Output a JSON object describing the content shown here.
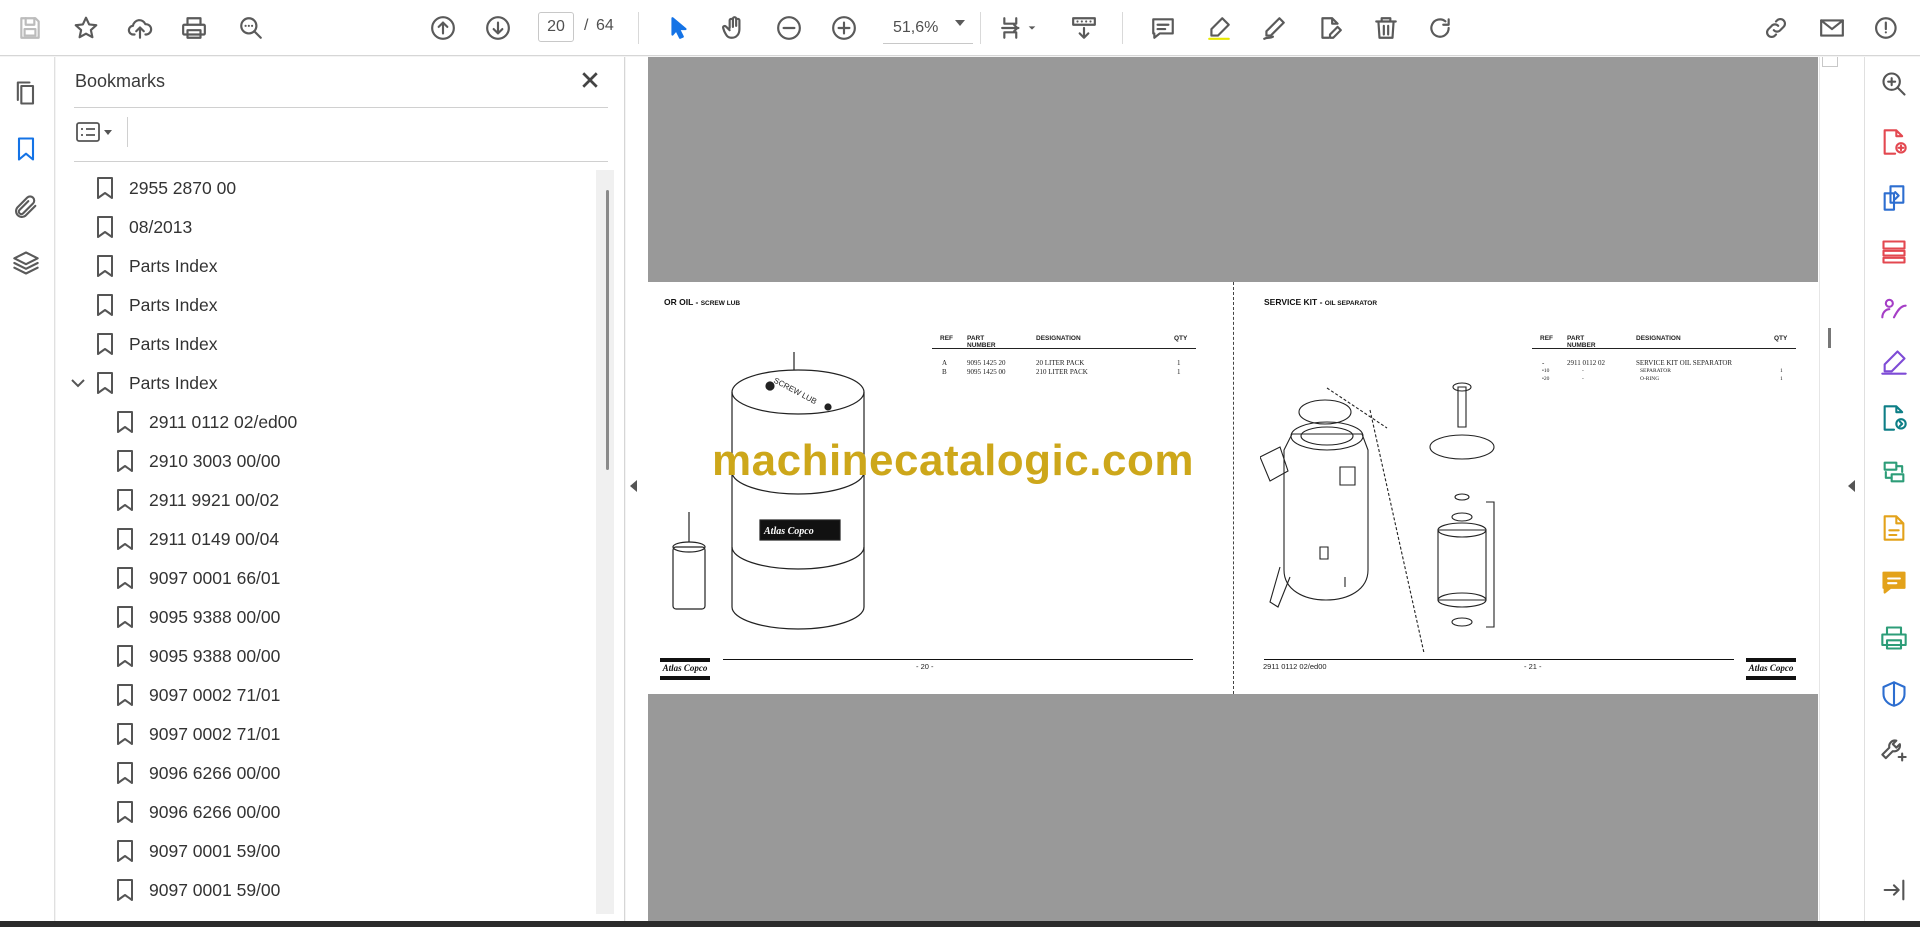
{
  "toolbar": {
    "page_current": "20",
    "page_separator": "/",
    "page_total": "64",
    "zoom_value": "51,6%"
  },
  "bookmarks": {
    "title": "Bookmarks",
    "items": [
      {
        "label": "2955 2870 00"
      },
      {
        "label": "08/2013"
      },
      {
        "label": "Parts Index"
      },
      {
        "label": "Parts Index"
      },
      {
        "label": "Parts Index"
      },
      {
        "label": "Parts Index"
      },
      {
        "label": "2911 0112 02/ed00"
      },
      {
        "label": "2910 3003 00/00"
      },
      {
        "label": "2911 9921 00/02"
      },
      {
        "label": "2911 0149 00/04"
      },
      {
        "label": "9097 0001 66/01"
      },
      {
        "label": "9095 9388 00/00"
      },
      {
        "label": "9095 9388 00/00"
      },
      {
        "label": "9097 0002 71/01"
      },
      {
        "label": "9097 0002 71/01"
      },
      {
        "label": "9096 6266 00/00"
      },
      {
        "label": "9096 6266 00/00"
      },
      {
        "label": "9097 0001 59/00"
      },
      {
        "label": "9097 0001 59/00"
      }
    ]
  },
  "document": {
    "left_page": {
      "heading": "OR OIL - ",
      "heading_small": "SCREW LUB",
      "columns": [
        "REF",
        "PART NUMBER",
        "DESIGNATION",
        "QTY"
      ],
      "rows": [
        {
          "ref": "A",
          "part": "9095 1425 20",
          "designation": "20 LITER PACK",
          "qty": "1"
        },
        {
          "ref": "B",
          "part": "9095 1425 00",
          "designation": "210 LITER PACK",
          "qty": "1"
        }
      ],
      "drum_label_1": "SCREW LUB",
      "drum_label_2": "Atlas Copco",
      "page_number": "- 20 -",
      "logo": "Atlas Copco"
    },
    "right_page": {
      "heading": "SERVICE KIT - ",
      "heading_small": "OIL SEPARATOR",
      "columns": [
        "REF",
        "PART NUMBER",
        "DESIGNATION",
        "QTY"
      ],
      "rows": [
        {
          "ref": "-",
          "part": "2911 0112 02",
          "designation": "SERVICE KIT OIL SEPARATOR",
          "qty": ""
        },
        {
          "ref": "•10",
          "part": "-",
          "designation": "SEPARATOR",
          "qty": "1"
        },
        {
          "ref": "•20",
          "part": "-",
          "designation": "O-RING",
          "qty": "1"
        }
      ],
      "doc_code": "2911 0112 02/ed00",
      "page_number": "- 21 -",
      "logo": "Atlas Copco"
    },
    "watermark": "machinecatalogic.com"
  }
}
